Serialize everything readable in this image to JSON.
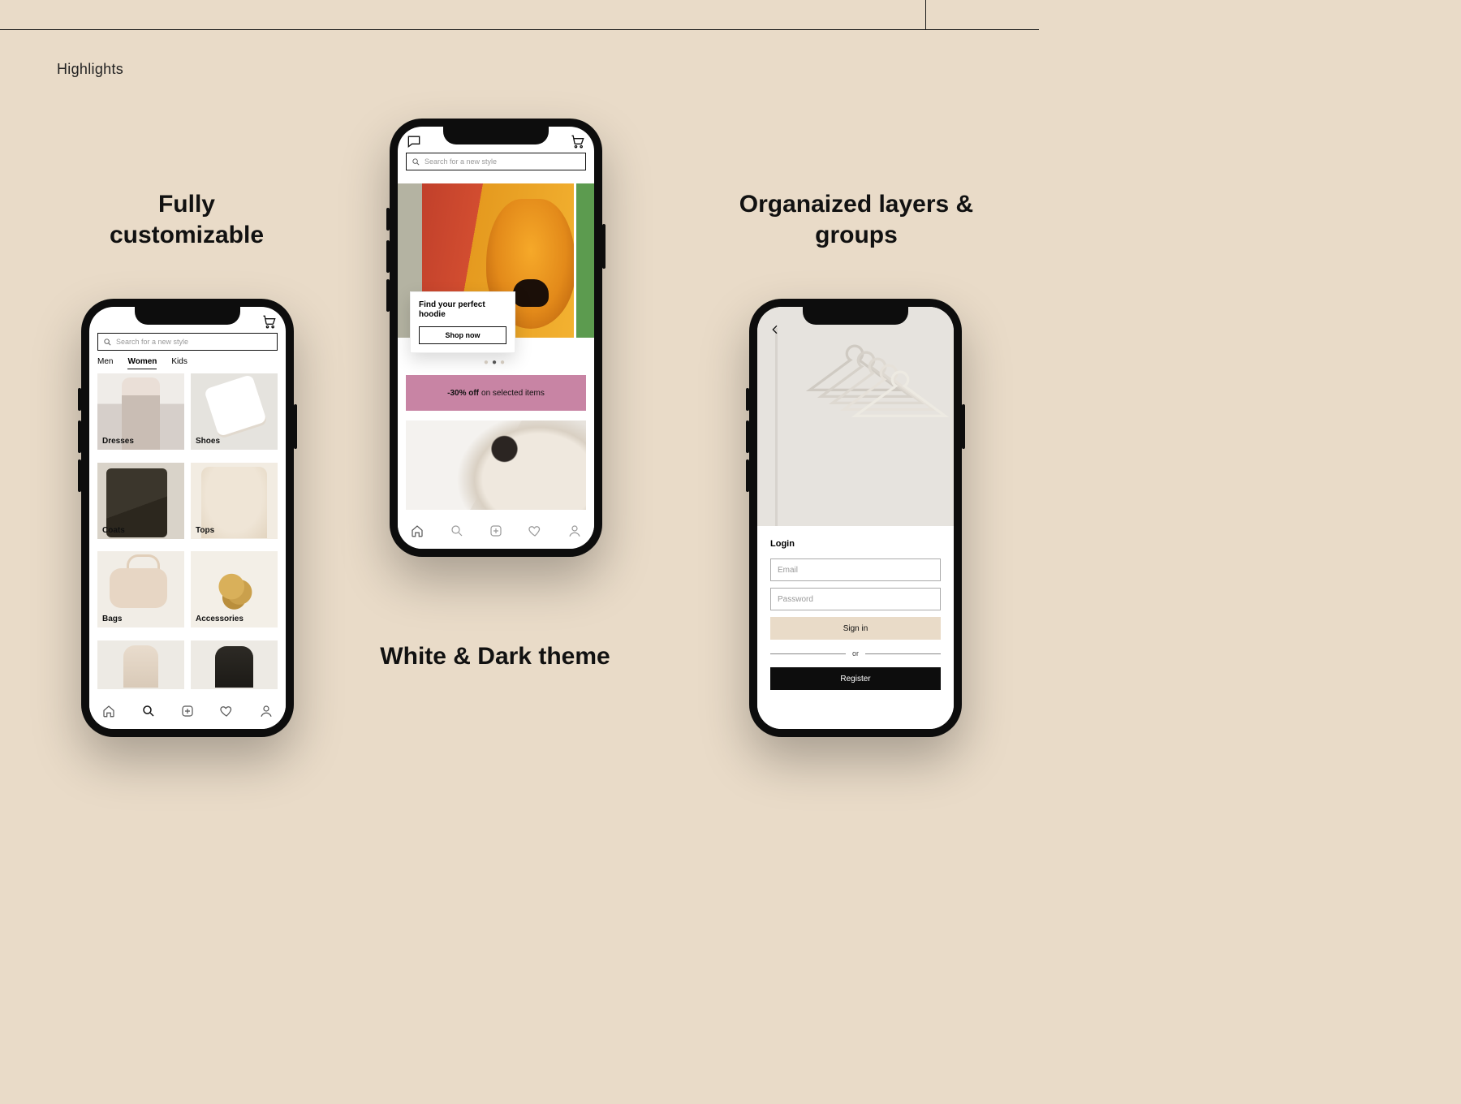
{
  "section_title": "Highlights",
  "features": {
    "left": "Fully customizable",
    "mid": "White & Dark theme",
    "right": "Organaized layers & groups"
  },
  "phone1": {
    "search_placeholder": "Search for a new style",
    "tabs": {
      "men": "Men",
      "women": "Women",
      "kids": "Kids"
    },
    "categories": {
      "dresses": "Dresses",
      "shoes": "Shoes",
      "coats": "Coats",
      "tops": "Tops",
      "bags": "Bags",
      "accessories": "Accessories"
    }
  },
  "phone2": {
    "search_placeholder": "Search for a new style",
    "hero_title": "Find your perfect hoodie",
    "hero_cta": "Shop now",
    "banner_bold": "-30% off",
    "banner_rest": " on selected items"
  },
  "phone3": {
    "login_heading": "Login",
    "email_placeholder": "Email",
    "password_placeholder": "Password",
    "signin": "Sign in",
    "or": "or",
    "register": "Register"
  }
}
